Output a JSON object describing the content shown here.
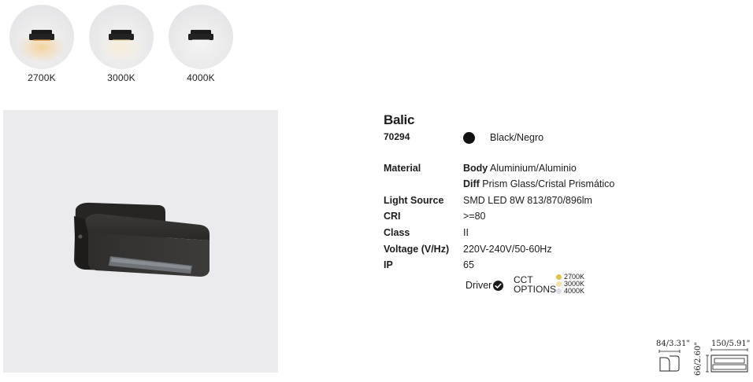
{
  "swatches": [
    {
      "label": "2700K",
      "glow": "#f3c98a"
    },
    {
      "label": "3000K",
      "glow": "#f6e6c8"
    },
    {
      "label": "4000K",
      "glow": "#f2f2f0"
    }
  ],
  "product": {
    "name": "Balic",
    "code": "70294",
    "color_name": "Black/Negro",
    "color_hex": "#111111"
  },
  "specs": {
    "material_label": "Material",
    "body_key": "Body",
    "body_value": " Aluminium/Aluminio",
    "diff_key": "Diff",
    "diff_value": " Prism Glass/Cristal Prismático",
    "light_source_label": "Light Source",
    "light_source_value": "SMD LED 8W  813/870/896lm",
    "cri_label": "CRI",
    "cri_value": ">=80",
    "class_label": "Class",
    "class_value": "II",
    "voltage_label": "Voltage (V/Hz)",
    "voltage_value": "220V-240V/50-60Hz",
    "ip_label": "IP",
    "ip_value": "65"
  },
  "driver": {
    "label": "Driver",
    "cct_line1": "CCT",
    "cct_line2": "OPTIONS",
    "options": [
      {
        "label": "2700K",
        "color": "#e2c34a"
      },
      {
        "label": "3000K",
        "color": "#f0e2a8"
      },
      {
        "label": "4000K",
        "color": "#dcdce6"
      }
    ]
  },
  "dimensions": {
    "depth": "84/3.31\"",
    "width": "150/5.91\"",
    "height": "66/2.60\""
  }
}
